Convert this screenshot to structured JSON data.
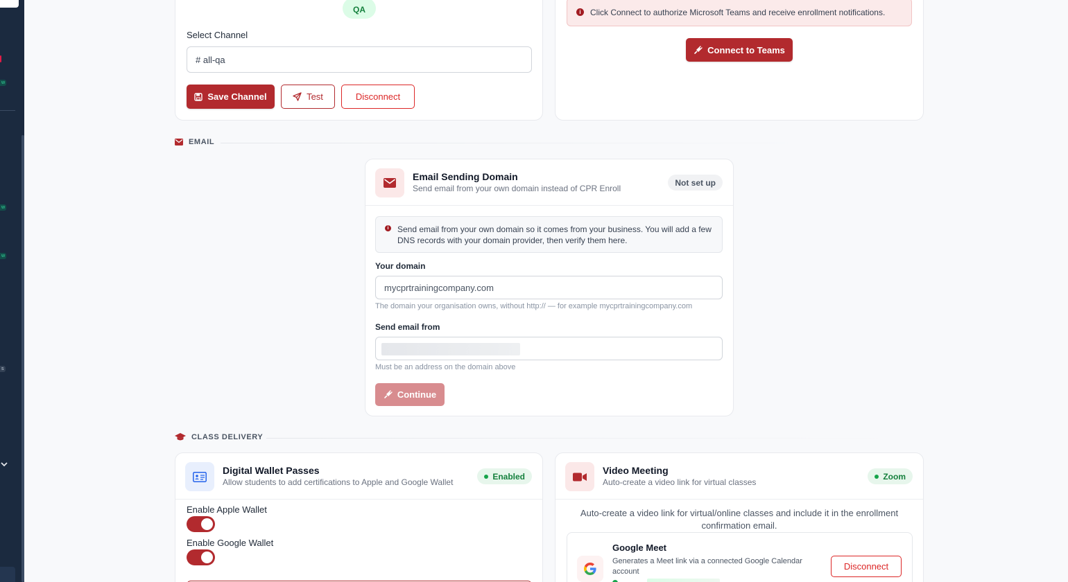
{
  "sidebar": {
    "badges": [
      "w",
      "w",
      "w",
      "w",
      "s"
    ]
  },
  "slack": {
    "workspace_chip": "QA",
    "select_channel_label": "Select Channel",
    "channel_value": "# all-qa",
    "save_label": "Save Channel",
    "test_label": "Test",
    "disconnect_label": "Disconnect"
  },
  "teams": {
    "alert_text": "Click Connect to authorize Microsoft Teams and receive enrollment notifications.",
    "connect_label": "Connect to Teams"
  },
  "email_section": {
    "title": "EMAIL"
  },
  "email_domain": {
    "title": "Email Sending Domain",
    "subtitle": "Send email from your own domain instead of CPR Enroll",
    "status": "Not set up",
    "info": "Send email from your own domain so it comes from your business. You will add a few DNS records with your domain provider, then verify them here.",
    "domain_label": "Your domain",
    "domain_placeholder": "mycprtrainingcompany.com",
    "domain_hint": "The domain your organisation owns, without http:// — for example mycprtrainingcompany.com",
    "from_label": "Send email from",
    "from_hint": "Must be an address on the domain above",
    "continue_label": "Continue"
  },
  "class_delivery": {
    "title": "CLASS DELIVERY"
  },
  "wallet": {
    "title": "Digital Wallet Passes",
    "subtitle": "Allow students to add certifications to Apple and Google Wallet",
    "status": "Enabled",
    "apple_label": "Enable Apple Wallet",
    "apple_enabled": true,
    "google_label": "Enable Google Wallet",
    "google_enabled": true
  },
  "video": {
    "title": "Video Meeting",
    "subtitle": "Auto-create a video link for virtual classes",
    "status": "Zoom",
    "description": "Auto-create a video link for virtual/online classes and include it in the enrollment confirmation email.",
    "meet_title": "Google Meet",
    "meet_desc": "Generates a Meet link via a connected Google Calendar account",
    "meet_disconnect": "Disconnect"
  },
  "colors": {
    "primary": "#b22a2e",
    "sidebar": "#1b2a3f",
    "success": "#15803d"
  }
}
